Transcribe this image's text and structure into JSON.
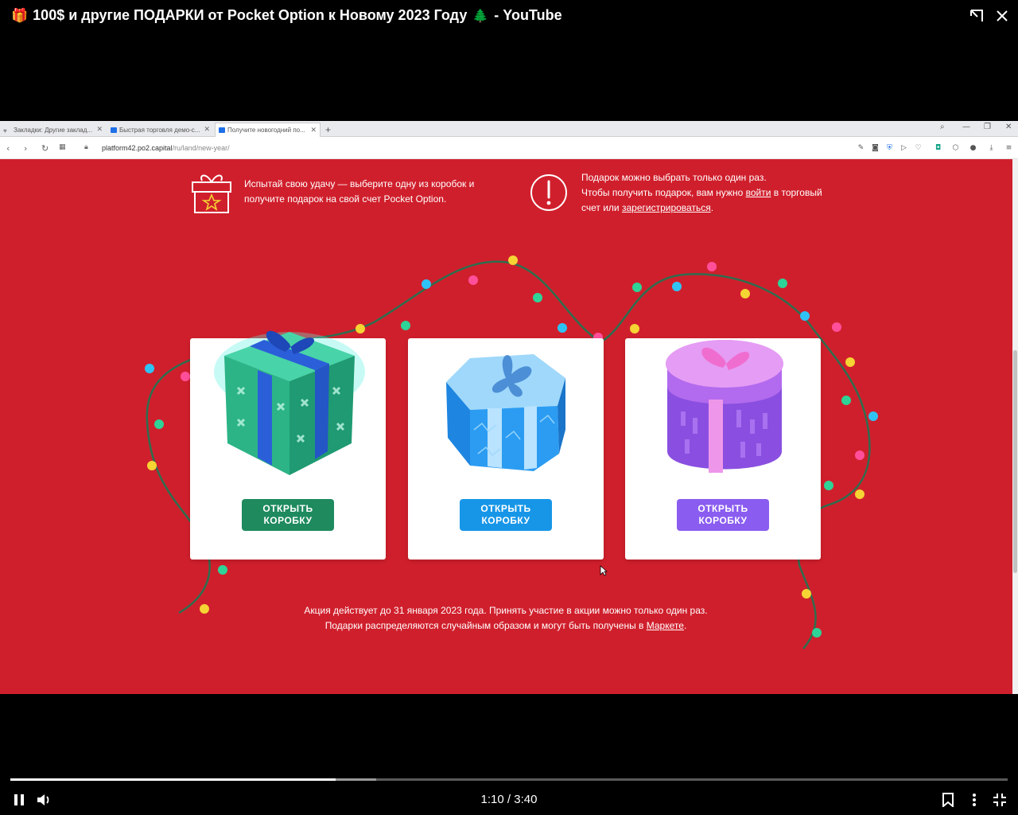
{
  "video": {
    "title": "100$ и другие ПОДАРКИ от Pocket Option к Новому 2023 Году",
    "title_suffix": "- YouTube",
    "title_icons": [
      "gift-emoji",
      "christmas-tree-emoji"
    ],
    "current_time": "1:10",
    "duration": "3:40",
    "time_separator": "/",
    "progress_fraction": 0.326,
    "buffered_fraction": 0.367
  },
  "browser": {
    "tabs": [
      {
        "label": "Закладки: Другие заклад...",
        "icon": "heart-icon"
      },
      {
        "label": "Быстрая торговля демо-с...",
        "icon": "pocket-option-icon"
      },
      {
        "label": "Получите новогодний по...",
        "icon": "pocket-option-icon",
        "active": true
      }
    ],
    "new_tab": "+",
    "url_domain": "platform42.po2.capital",
    "url_path": "/ru/land/new-year/"
  },
  "page": {
    "info_left": "Испытай свою удачу — выберите одну из коробок и получите подарок на свой счет Pocket Option.",
    "info_right_1": "Подарок можно выбрать только один раз.",
    "info_right_2a": "Чтобы получить подарок, вам нужно ",
    "info_right_login": "войти",
    "info_right_2b": " в торговый счет или ",
    "info_right_register": "зарегистрироваться",
    "info_right_2c": ".",
    "cards": [
      {
        "button_line1": "ОТКРЫТЬ",
        "button_line2": "КОРОБКУ",
        "button_color": "#1e8a5e",
        "box": "green-cube-gift"
      },
      {
        "button_line1": "ОТКРЫТЬ",
        "button_line2": "КОРОБКУ",
        "button_color": "#1796e8",
        "box": "blue-hexagon-gift"
      },
      {
        "button_line1": "ОТКРЫТЬ",
        "button_line2": "КОРОБКУ",
        "button_color": "#8a5cf0",
        "box": "purple-round-gift"
      }
    ],
    "footer_a": "Акция действует до 31 января 2023 года. Принять участие в акции можно только один раз. Подарки распределяются случайным образом и могут быть получены в ",
    "footer_link": "Маркете",
    "footer_b": ".",
    "background_color": "#d01f2c"
  }
}
